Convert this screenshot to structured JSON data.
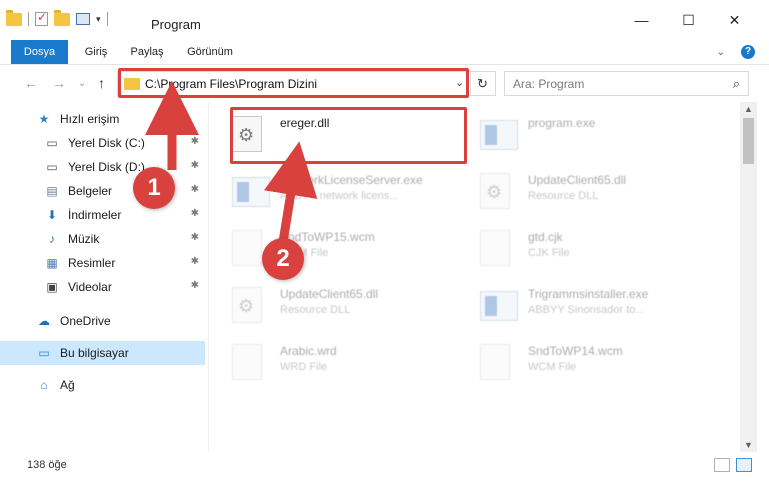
{
  "window": {
    "title": "Program",
    "minimize_glyph": "—",
    "maximize_glyph": "☐",
    "close_glyph": "✕",
    "quick_access_dropdown": "▾"
  },
  "ribbon": {
    "tabs": [
      "Dosya",
      "Giriş",
      "Paylaş",
      "Görünüm"
    ],
    "expand_glyph": "⌄",
    "help_glyph": "?"
  },
  "nav": {
    "back_glyph": "←",
    "forward_glyph": "→",
    "recent_glyph": "⌄",
    "up_glyph": "↑",
    "address": "C:\\Program Files\\Program Dizini",
    "address_dropdown_glyph": "⌄",
    "refresh_glyph": "↻",
    "search_placeholder": "Ara: Program",
    "search_glyph": "⌕"
  },
  "sidebar": {
    "items": [
      {
        "label": "Hızlı erişim",
        "icon": "star-icon",
        "glyph": "★",
        "color": "#2f80d1",
        "pinned": false
      },
      {
        "label": "Yerel Disk (C:)",
        "icon": "drive-icon",
        "glyph": "▭",
        "color": "#555555",
        "pinned": true
      },
      {
        "label": "Yerel Disk (D:)",
        "icon": "drive-icon",
        "glyph": "▭",
        "color": "#555555",
        "pinned": true
      },
      {
        "label": "Belgeler",
        "icon": "documents-icon",
        "glyph": "▤",
        "color": "#6b7c93",
        "pinned": true
      },
      {
        "label": "İndirmeler",
        "icon": "download-icon",
        "glyph": "⬇",
        "color": "#1f6fc1",
        "pinned": true
      },
      {
        "label": "Müzik",
        "icon": "music-icon",
        "glyph": "♪",
        "color": "#1f6fc1",
        "pinned": true
      },
      {
        "label": "Resimler",
        "icon": "pictures-icon",
        "glyph": "▦",
        "color": "#4a7ab8",
        "pinned": true
      },
      {
        "label": "Videolar",
        "icon": "video-icon",
        "glyph": "▣",
        "color": "#444444",
        "pinned": true
      },
      {
        "label": "OneDrive",
        "icon": "cloud-icon",
        "glyph": "☁",
        "color": "#1f6fc1",
        "pinned": false
      },
      {
        "label": "Bu bilgisayar",
        "icon": "computer-icon",
        "glyph": "▭",
        "color": "#2f80d1",
        "pinned": false
      },
      {
        "label": "Ağ",
        "icon": "network-icon",
        "glyph": "⌂",
        "color": "#2f80d1",
        "pinned": false
      }
    ],
    "pin_glyph": "📌"
  },
  "files": [
    {
      "name": "ereger.dll",
      "type": "",
      "kind": "dll",
      "highlighted": true
    },
    {
      "name": "program.exe",
      "type": "",
      "kind": "exe",
      "highlighted": false
    },
    {
      "name": "NetworkLicenseServer.exe",
      "type": "ABBYY network licens...",
      "kind": "exe",
      "highlighted": false
    },
    {
      "name": "UpdateClient65.dll",
      "type": "Resource DLL",
      "kind": "dll",
      "highlighted": false
    },
    {
      "name": "SndToWP15.wcm",
      "type": "WCM File",
      "kind": "doc",
      "highlighted": false
    },
    {
      "name": "gtd.cjk",
      "type": "CJK File",
      "kind": "doc",
      "highlighted": false
    },
    {
      "name": "UpdateClient65.dll",
      "type": "Resource DLL",
      "kind": "dll",
      "highlighted": false
    },
    {
      "name": "Trigrammsinstaller.exe",
      "type": "ABBYY Sinonsador to...",
      "kind": "exe",
      "highlighted": false
    },
    {
      "name": "Arabic.wrd",
      "type": "WRD File",
      "kind": "doc",
      "highlighted": false
    },
    {
      "name": "SndToWP14.wcm",
      "type": "WCM File",
      "kind": "doc",
      "highlighted": false
    }
  ],
  "status": {
    "item_count": "138 öğe"
  },
  "annotations": {
    "step1": "1",
    "step2": "2",
    "color": "#d8413e"
  }
}
